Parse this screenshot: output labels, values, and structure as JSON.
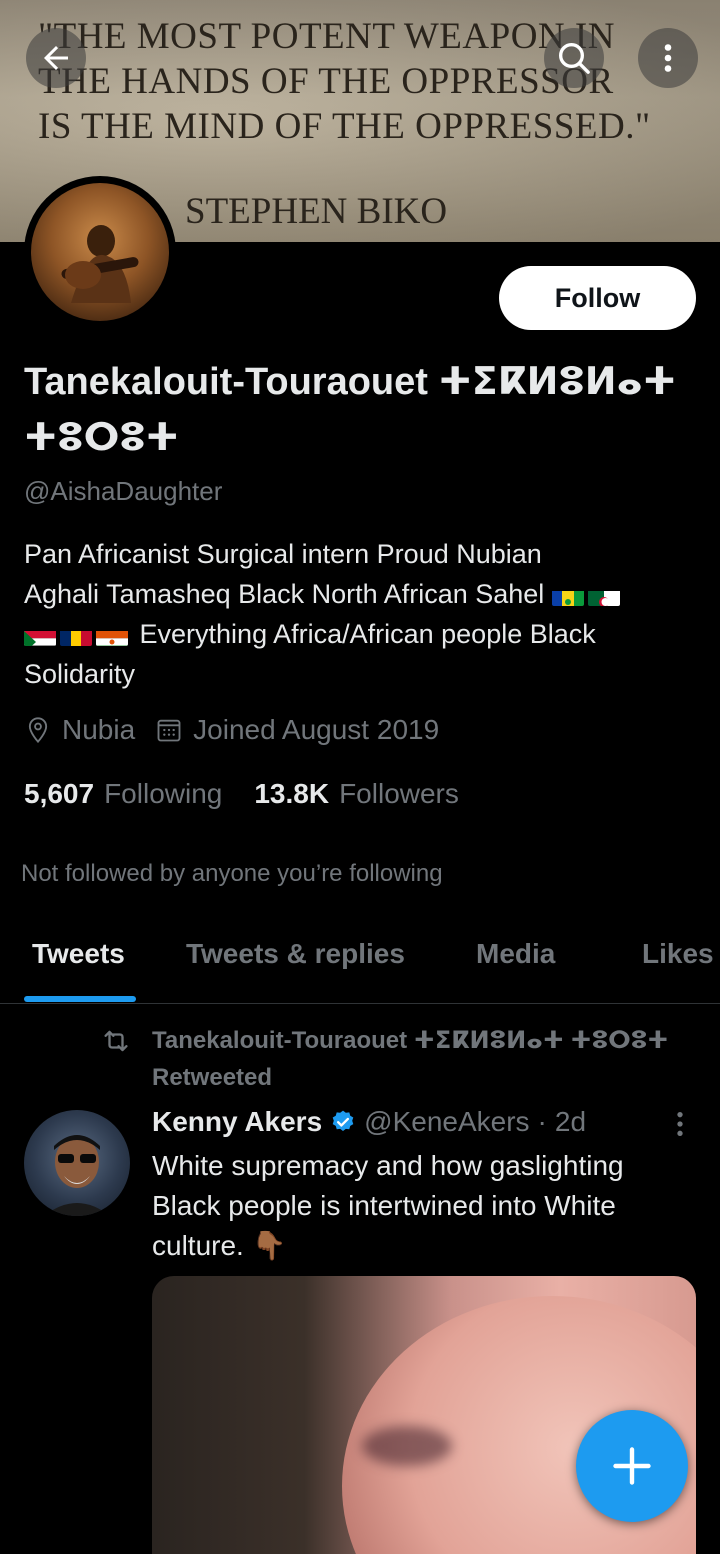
{
  "banner": {
    "quote_lines": [
      "\"THE MOST POTENT WEAPON IN",
      "THE HANDS OF THE OPPRESSOR",
      "IS THE MIND OF THE OPPRESSED.\""
    ],
    "attribution": "STEPHEN BIKO"
  },
  "profile": {
    "follow_label": "Follow",
    "name": "Tanekalouit-Touraouet ⵜⵉⴽⵍⵓⵍⴰⵜ ⵜⵓⵔⵓⵜ",
    "handle": "@AishaDaughter",
    "bio_line1": "Pan Africanist  Surgical intern Proud Nubian",
    "bio_line2": "Aghali Tamasheq Black North African Sahel",
    "bio_line3": "Everything Africa/African people  Black",
    "bio_line4": "Solidarity",
    "location": "Nubia",
    "joined": "Joined August 2019",
    "following_count": "5,607",
    "following_label": "Following",
    "followers_count": "13.8K",
    "followers_label": "Followers",
    "not_followed": "Not followed by anyone you’re following"
  },
  "tabs": [
    "Tweets",
    "Tweets & replies",
    "Media",
    "Likes"
  ],
  "tweet": {
    "retweeted_by": "Tanekalouit-Touraouet ⵜⵉⴽⵍⵓⵍⴰⵜ ⵜⵓⵔⵓⵜ Retweeted",
    "author": "Kenny Akers",
    "handle": "@KeneAkers",
    "dot": "·",
    "time": "2d",
    "text": "White supremacy and how gaslighting Black people is intertwined into White culture. 👇🏾"
  },
  "colors": {
    "accent": "#1d9bf0",
    "background": "#000000",
    "muted": "#71767b"
  },
  "icons": [
    "back-arrow-icon",
    "search-icon",
    "more-vertical-icon",
    "location-pin-icon",
    "calendar-icon",
    "retweet-icon",
    "verified-badge-icon",
    "compose-plus-icon"
  ]
}
